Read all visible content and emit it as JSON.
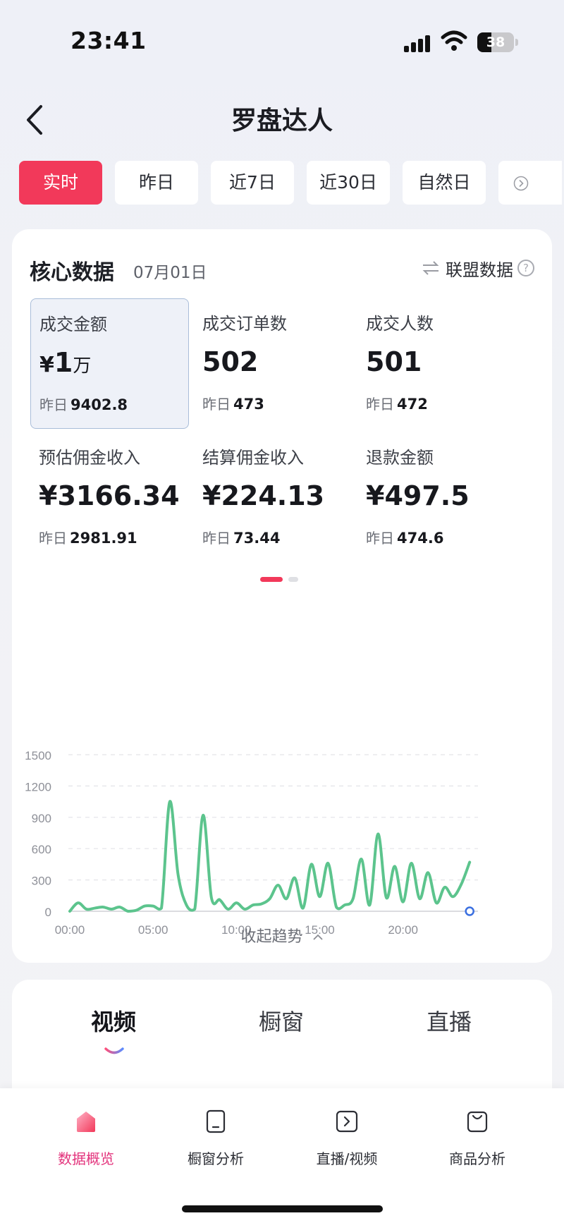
{
  "status_bar": {
    "time": "23:41",
    "battery": "38"
  },
  "header": {
    "title": "罗盘达人"
  },
  "date_tabs": [
    "实时",
    "昨日",
    "近7日",
    "近30日",
    "自然日"
  ],
  "core": {
    "title": "核心数据",
    "date": "07月01日",
    "alliance_label": "联盟数据",
    "yesterday_label": "昨日",
    "metrics": [
      {
        "label": "成交金额",
        "currency": "¥",
        "value": "1",
        "unit": "万",
        "yesterday": "9402.8"
      },
      {
        "label": "成交订单数",
        "value": "502",
        "yesterday": "473"
      },
      {
        "label": "成交人数",
        "value": "501",
        "yesterday": "472"
      },
      {
        "label": "预估佣金收入",
        "value": "¥3166.34",
        "yesterday": "2981.91"
      },
      {
        "label": "结算佣金收入",
        "value": "¥224.13",
        "yesterday": "73.44"
      },
      {
        "label": "退款金额",
        "value": "¥497.5",
        "yesterday": "474.6"
      }
    ],
    "collapse_label": "收起趋势"
  },
  "chart_data": {
    "type": "line",
    "x_ticks": [
      "00:00",
      "05:00",
      "10:00",
      "15:00",
      "20:00"
    ],
    "y_ticks": [
      0,
      300,
      600,
      900,
      1200,
      1500
    ],
    "ylim": [
      0,
      1500
    ],
    "xlim_hours": [
      0,
      24.5
    ],
    "grid": true,
    "line_color": "#5cc48d",
    "series": [
      {
        "x": [
          0,
          0.5,
          1,
          1.5,
          2,
          2.5,
          3,
          3.5,
          4,
          4.5,
          5,
          5.5,
          6,
          6.5,
          7,
          7.5,
          8,
          8.5,
          9,
          9.5,
          10,
          10.5,
          11,
          11.5,
          12,
          12.5,
          13,
          13.5,
          14,
          14.5,
          15,
          15.5,
          16,
          16.5,
          17,
          17.5,
          18,
          18.5,
          19,
          19.5,
          20,
          20.5,
          21,
          21.5,
          22,
          22.5,
          23,
          23.5,
          24
        ],
        "y": [
          0,
          80,
          20,
          30,
          40,
          20,
          40,
          0,
          10,
          50,
          50,
          30,
          1050,
          350,
          60,
          20,
          920,
          130,
          110,
          20,
          80,
          20,
          60,
          70,
          120,
          250,
          120,
          320,
          30,
          450,
          140,
          460,
          40,
          60,
          120,
          500,
          60,
          740,
          130,
          430,
          90,
          460,
          120,
          370,
          80,
          230,
          140,
          260,
          470
        ]
      }
    ],
    "current_point": {
      "x": 24.0,
      "y": 0
    }
  },
  "content_tabs": [
    "视频",
    "橱窗",
    "直播"
  ],
  "bottom_nav": [
    {
      "label": "数据概览",
      "icon": "home-icon"
    },
    {
      "label": "橱窗分析",
      "icon": "tablet-icon"
    },
    {
      "label": "直播/视频",
      "icon": "play-box-icon"
    },
    {
      "label": "商品分析",
      "icon": "bag-icon"
    }
  ],
  "colors": {
    "accent": "#f2395a",
    "line": "#5cc48d",
    "active_nav": "#e3337c"
  }
}
